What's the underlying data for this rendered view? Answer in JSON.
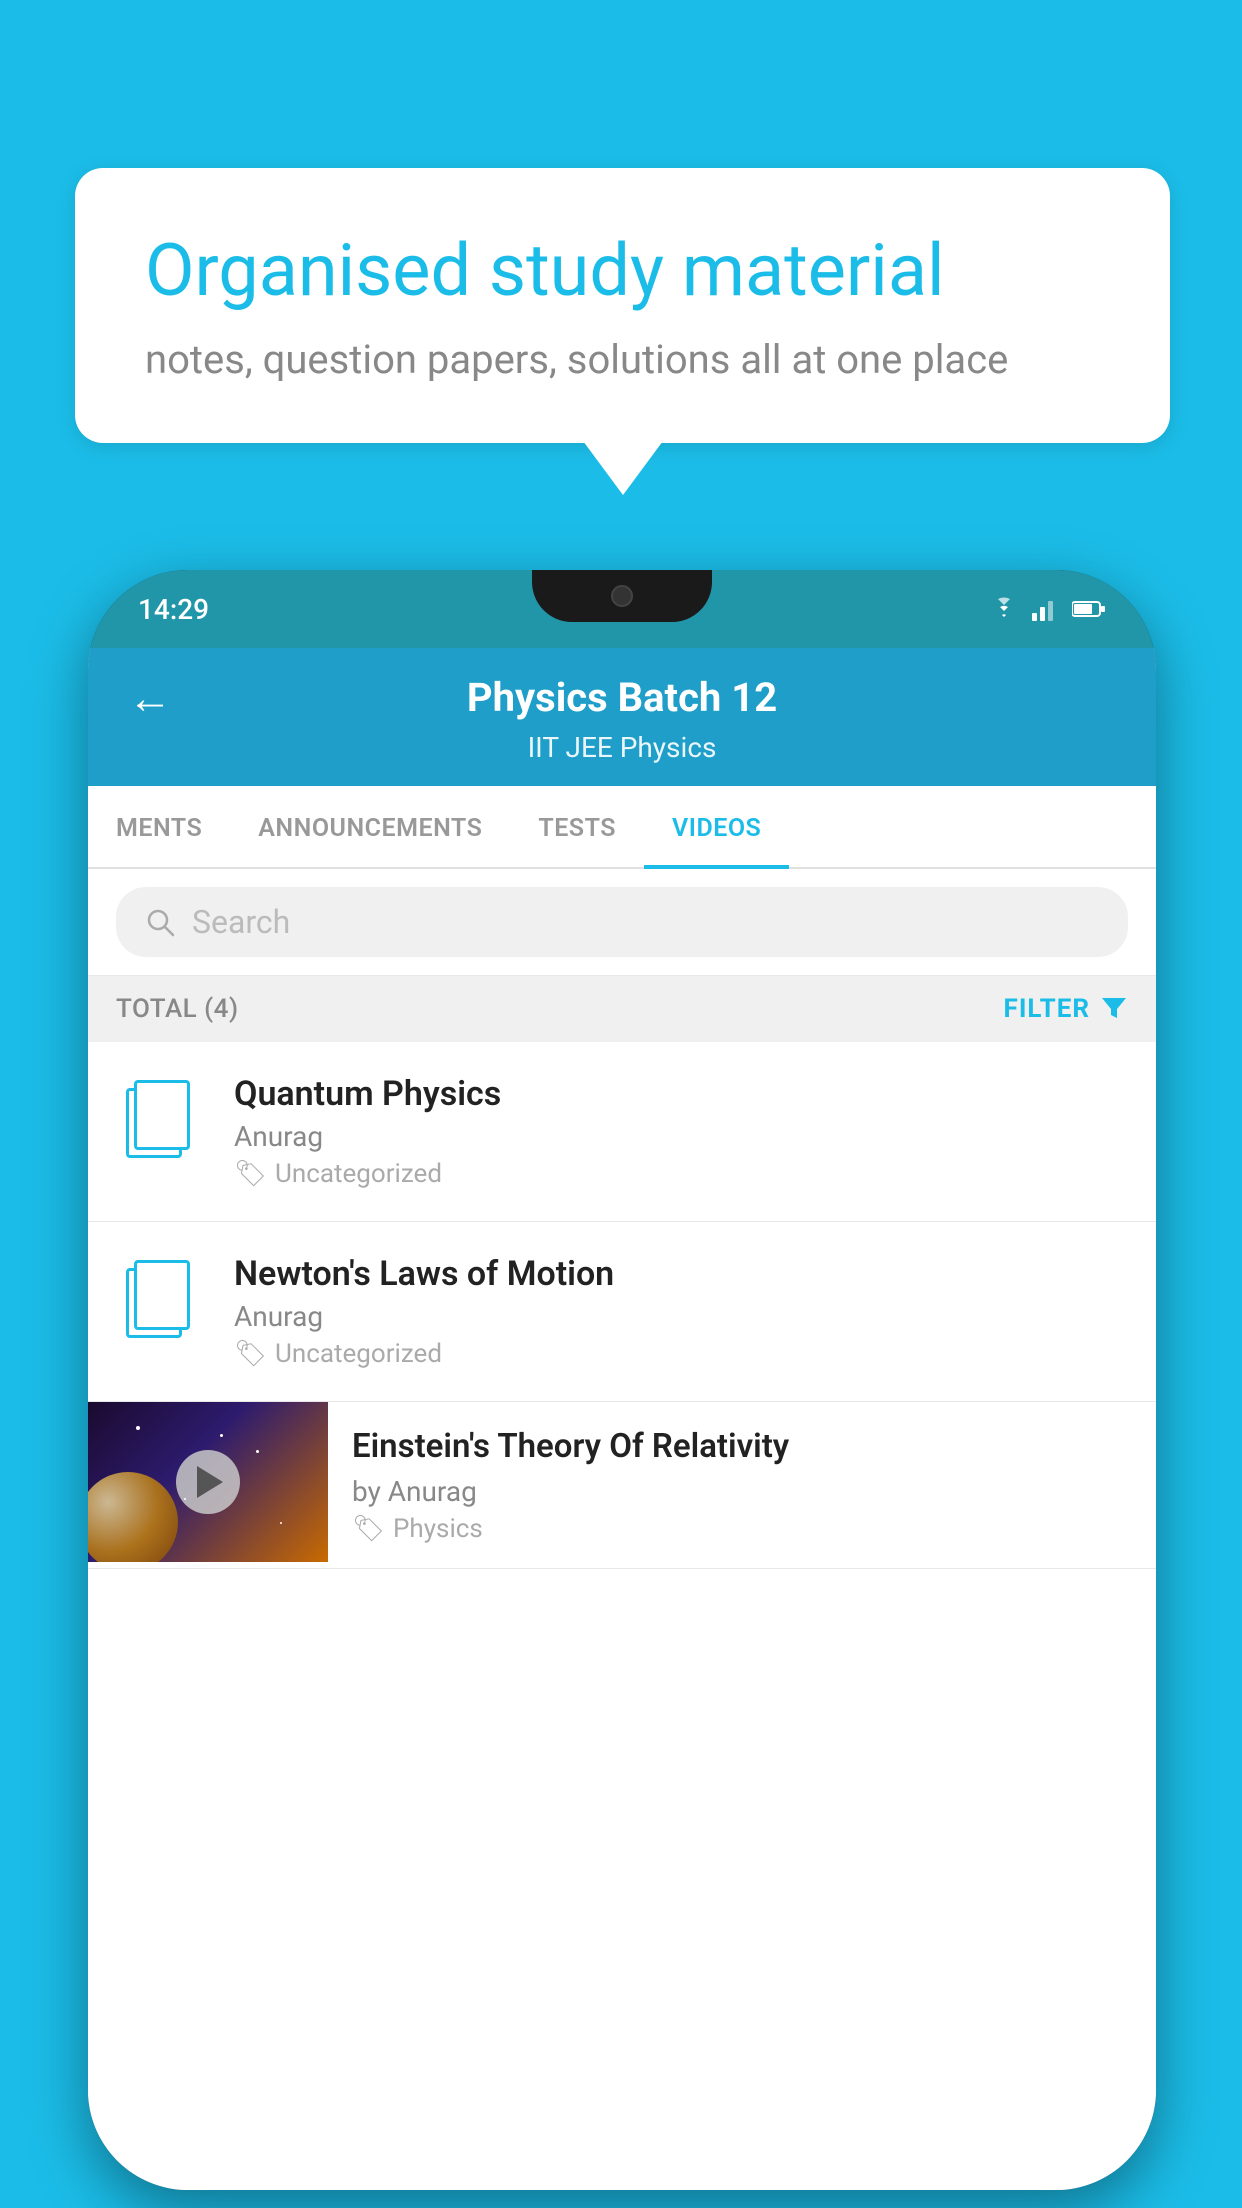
{
  "background_color": "#1bbde8",
  "bubble": {
    "title": "Organised study material",
    "subtitle": "notes, question papers, solutions all at one place"
  },
  "phone": {
    "status_bar": {
      "time": "14:29"
    },
    "header": {
      "title": "Physics Batch 12",
      "subtitle": "IIT JEE   Physics",
      "back_label": "←"
    },
    "tabs": [
      {
        "label": "MENTS",
        "active": false
      },
      {
        "label": "ANNOUNCEMENTS",
        "active": false
      },
      {
        "label": "TESTS",
        "active": false
      },
      {
        "label": "VIDEOS",
        "active": true
      }
    ],
    "search": {
      "placeholder": "Search"
    },
    "filter": {
      "total_label": "TOTAL (4)",
      "filter_label": "FILTER"
    },
    "items": [
      {
        "type": "folder",
        "title": "Quantum Physics",
        "author": "Anurag",
        "tag": "Uncategorized"
      },
      {
        "type": "folder",
        "title": "Newton's Laws of Motion",
        "author": "Anurag",
        "tag": "Uncategorized"
      },
      {
        "type": "video",
        "title": "Einstein's Theory Of Relativity",
        "author": "by Anurag",
        "tag": "Physics"
      }
    ]
  }
}
